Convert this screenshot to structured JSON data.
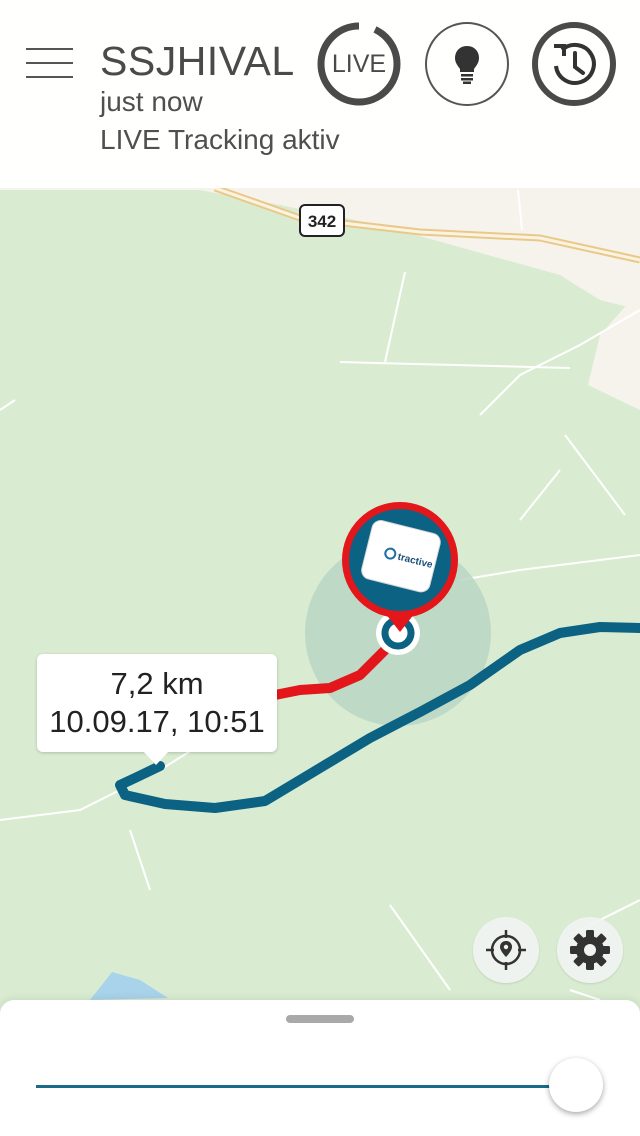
{
  "header": {
    "tracker_name": "SSJHIVAL",
    "last_update": "just now",
    "tracking_status": "LIVE Tracking aktiv",
    "live_button_label": "LIVE",
    "menu_icon": "hamburger-menu-icon",
    "bulb_icon": "lightbulb-icon",
    "history_icon": "history-clock-icon"
  },
  "map": {
    "road_shield": "342",
    "device_brand": "tractive",
    "colors": {
      "forest": "#d9ecd2",
      "open_land": "#f6f3ec",
      "track_history": "#0b6283",
      "track_live": "#e3161b",
      "water": "#a9d3ea"
    }
  },
  "info_bubble": {
    "distance": "7,2 km",
    "timestamp": "10.09.17, 10:51"
  },
  "map_controls": {
    "locate_icon": "locate-target-icon",
    "settings_icon": "gear-icon"
  },
  "timeline": {
    "slider_position": 1.0
  }
}
